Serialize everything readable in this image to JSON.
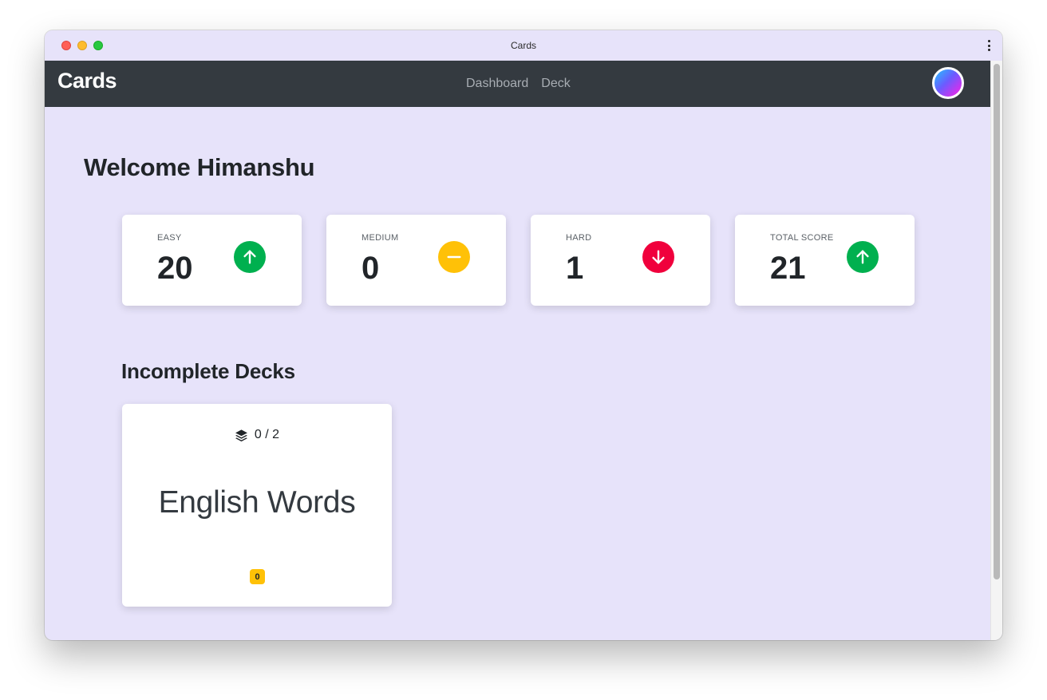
{
  "window": {
    "title": "Cards"
  },
  "navbar": {
    "brand": "Cards",
    "links": [
      {
        "label": "Dashboard"
      },
      {
        "label": "Deck"
      }
    ]
  },
  "welcome": {
    "greeting": "Welcome",
    "username": "Himanshu"
  },
  "stats": [
    {
      "label": "EASY",
      "value": "20",
      "icon": "arrow-up-icon",
      "color": "#00b04f"
    },
    {
      "label": "MEDIUM",
      "value": "0",
      "icon": "minus-icon",
      "color": "#ffc107"
    },
    {
      "label": "HARD",
      "value": "1",
      "icon": "arrow-down-icon",
      "color": "#f0003c"
    },
    {
      "label": "TOTAL SCORE",
      "value": "21",
      "icon": "arrow-up-icon",
      "color": "#00b04f"
    }
  ],
  "incomplete": {
    "title": "Incomplete Decks",
    "decks": [
      {
        "progress": "0 / 2",
        "name": "English Words",
        "badge": "0",
        "badge_color": "#ffc107"
      }
    ]
  },
  "colors": {
    "page_background": "#e7e3fa",
    "navbar": "#343a40",
    "success": "#00b04f",
    "warning": "#ffc107",
    "danger": "#f0003c"
  }
}
